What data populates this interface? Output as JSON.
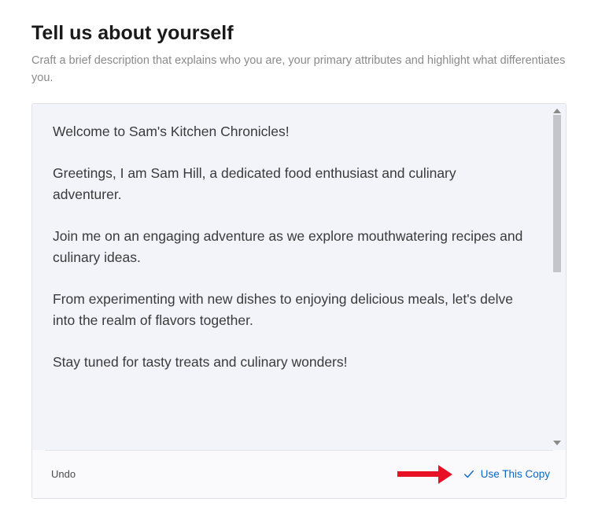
{
  "heading": "Tell us about yourself",
  "subheading": "Craft a brief description that explains who you are, your primary attributes and highlight what differentiates you.",
  "editor": {
    "paragraphs": [
      "Welcome to Sam's Kitchen Chronicles!",
      "Greetings, I am Sam Hill, a dedicated food enthusiast and culinary adventurer.",
      "Join me on an engaging adventure as we explore mouthwatering recipes and culinary ideas.",
      "From experimenting with new dishes to enjoying delicious meals, let's delve into the realm of flavors together.",
      "Stay tuned for tasty treats and culinary wonders!"
    ]
  },
  "footer": {
    "undo_label": "Undo",
    "use_copy_label": "Use This Copy"
  },
  "colors": {
    "link": "#0a66c2",
    "annotation": "#e81123"
  }
}
